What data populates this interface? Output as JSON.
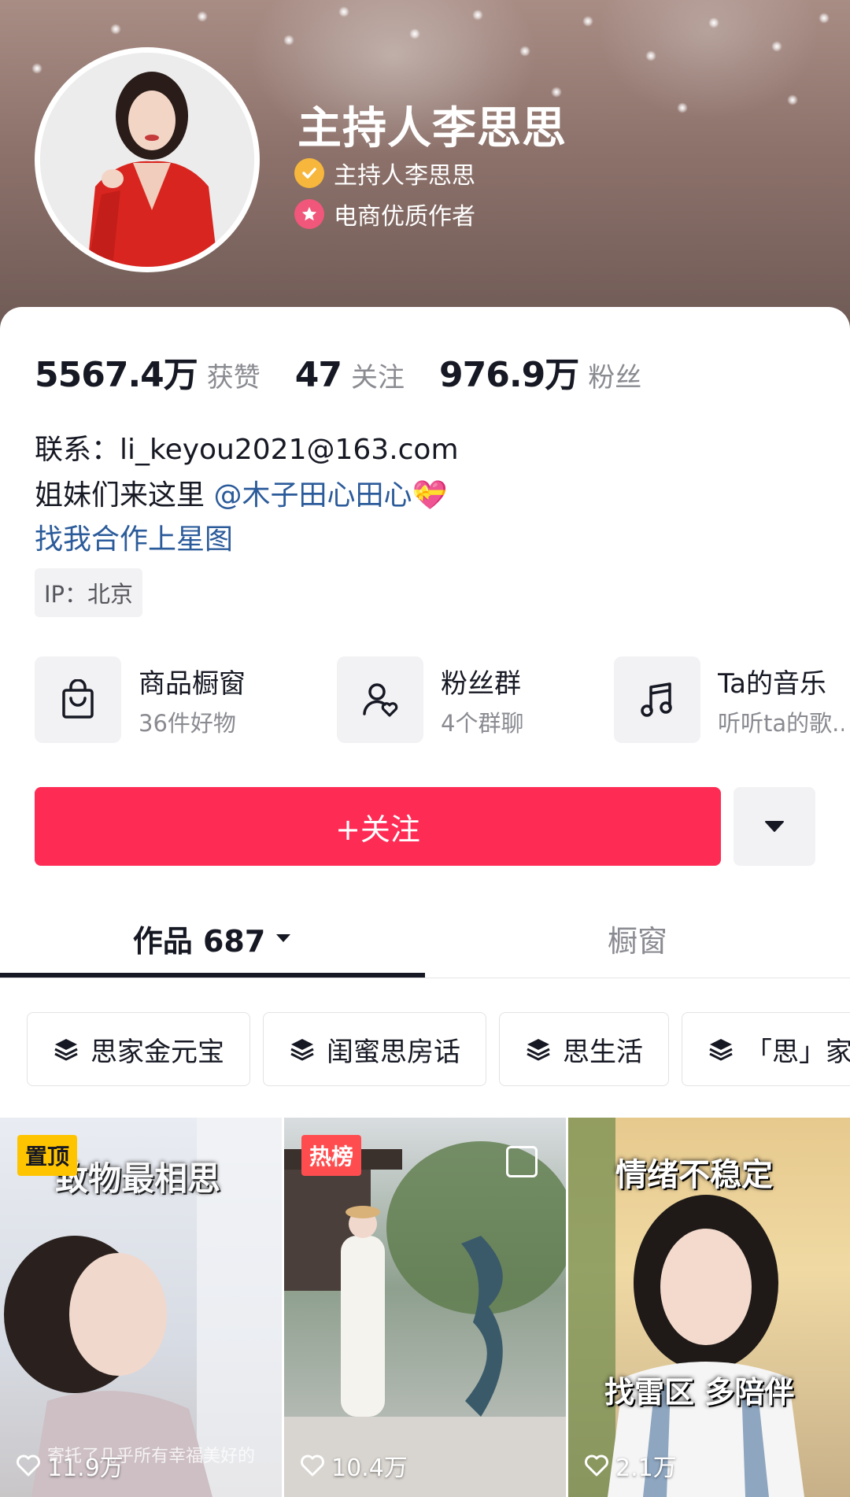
{
  "profile": {
    "nickname": "主持人李思思",
    "verified_label": "主持人李思思",
    "creator_label": "电商优质作者"
  },
  "stats": {
    "likes_value": "5567.4万",
    "likes_label": "获赞",
    "following_value": "47",
    "following_label": "关注",
    "followers_value": "976.9万",
    "followers_label": "粉丝"
  },
  "bio": {
    "contact": "联系：li_keyou2021@163.com",
    "line2_text": "姐妹们来这里 ",
    "line2_mention": "@木子田心田心",
    "line2_emoji": "💝",
    "star_map_link": "找我合作上星图",
    "ip": "IP：北京"
  },
  "tiles": [
    {
      "title": "商品橱窗",
      "subtitle": "36件好物",
      "icon": "shopping-bag-icon"
    },
    {
      "title": "粉丝群",
      "subtitle": "4个群聊",
      "icon": "fan-group-icon"
    },
    {
      "title": "Ta的音乐",
      "subtitle": "听听ta的歌...",
      "icon": "music-note-icon"
    }
  ],
  "actions": {
    "follow_label": "+关注",
    "more_icon": "caret-down-icon"
  },
  "tabs": {
    "works_label": "作品 687",
    "window_label": "橱窗"
  },
  "collections": [
    "思家金元宝",
    "闺蜜思房话",
    "思生活",
    "「思」家"
  ],
  "videos": [
    {
      "badge": "置顶",
      "overlay": "致物最相思",
      "caption": "寄托了几乎所有幸福美好的",
      "likes": "11.9万"
    },
    {
      "badge": "热榜",
      "likes": "10.4万"
    },
    {
      "overlay_top": "情绪不稳定",
      "overlay_bottom": "找雷区 多陪伴",
      "likes": "2.1万"
    }
  ],
  "colors": {
    "accent": "#fe2c55",
    "link": "#2b5b9a",
    "pinned_badge": "#ffc400",
    "hot_badge": "#ff4d4f"
  }
}
